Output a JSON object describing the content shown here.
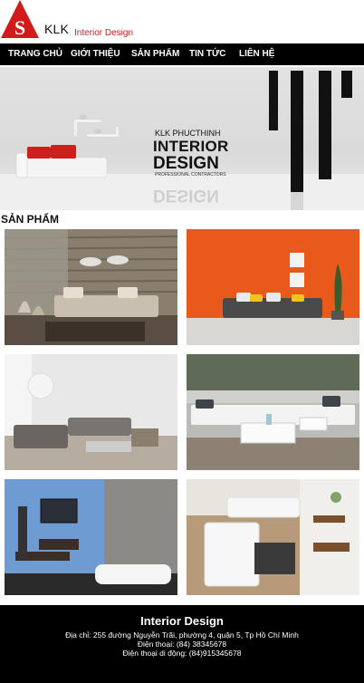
{
  "header": {
    "logo_text": "KLK",
    "logo_sub": "Interior Design"
  },
  "nav": {
    "items": [
      {
        "label": "TRANG CHỦ"
      },
      {
        "label": "GIỚI THIỆU"
      },
      {
        "label": "SẢN PHẨM"
      },
      {
        "label": "TIN TỨC"
      },
      {
        "label": "LIÊN HỆ"
      }
    ]
  },
  "hero": {
    "line1": "KLK PHUCTHINH",
    "line2": "INTERIOR",
    "line3": "DESIGN",
    "line4": "PROFESSIONAL CONTRACTORS",
    "reflection": "DESIGN"
  },
  "section": {
    "title": "SẢN PHẨM"
  },
  "footer": {
    "title": "Interior Design",
    "address": "Địa chỉ: 255 đường Nguyễn Trãi, phường 4, quận 5, Tp Hồ Chí Minh",
    "phone": "Điện thoại: (84) 38345678",
    "mobile": "Điện thoại di động: (84)915345678"
  },
  "colors": {
    "brand_red": "#d11a1a",
    "nav_bg": "#000000",
    "footer_bg": "#000000"
  }
}
